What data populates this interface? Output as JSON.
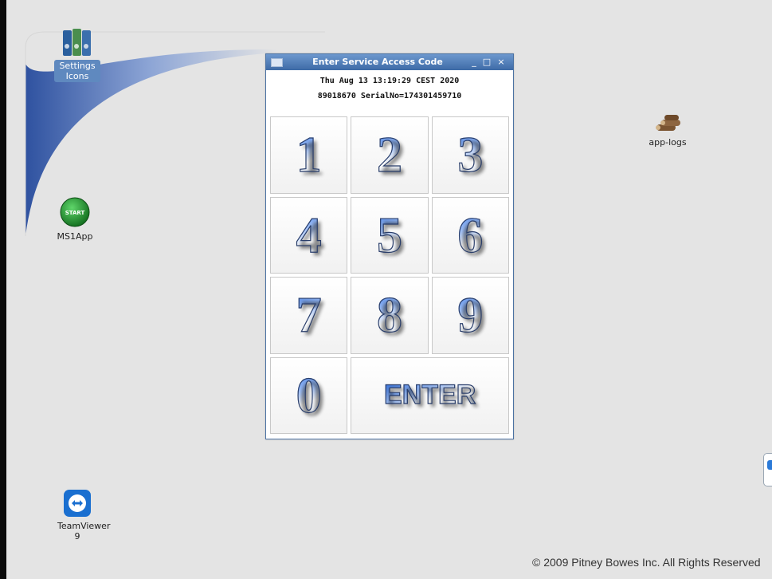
{
  "desktop": {
    "icons": {
      "settings": {
        "label": "Settings Icons",
        "icon": "settings-binders-icon"
      },
      "ms1app": {
        "label": "MS1App",
        "badge": "START",
        "icon": "start-button-icon"
      },
      "teamviewer": {
        "label": "TeamViewer 9",
        "icon": "teamviewer-icon"
      },
      "applogs": {
        "label": "app-logs",
        "icon": "logs-icon"
      }
    },
    "copyright": "© 2009 Pitney Bowes Inc. All Rights Reserved"
  },
  "dialog": {
    "title": "Enter Service Access Code",
    "window_buttons": {
      "minimize": "_",
      "maximize": "□",
      "close": "×"
    },
    "datetime": "Thu Aug 13 13:19:29 CEST 2020",
    "serial_line": "89018670 SerialNo=174301459710",
    "keys": [
      "1",
      "2",
      "3",
      "4",
      "5",
      "6",
      "7",
      "8",
      "9",
      "0"
    ],
    "enter_label": "ENTER"
  },
  "colors": {
    "desktop_bg": "#e4e4e4",
    "swoosh_blue": "#3d5fa8",
    "titlebar": "#4f7db8",
    "start_green": "#1d8f2a"
  }
}
